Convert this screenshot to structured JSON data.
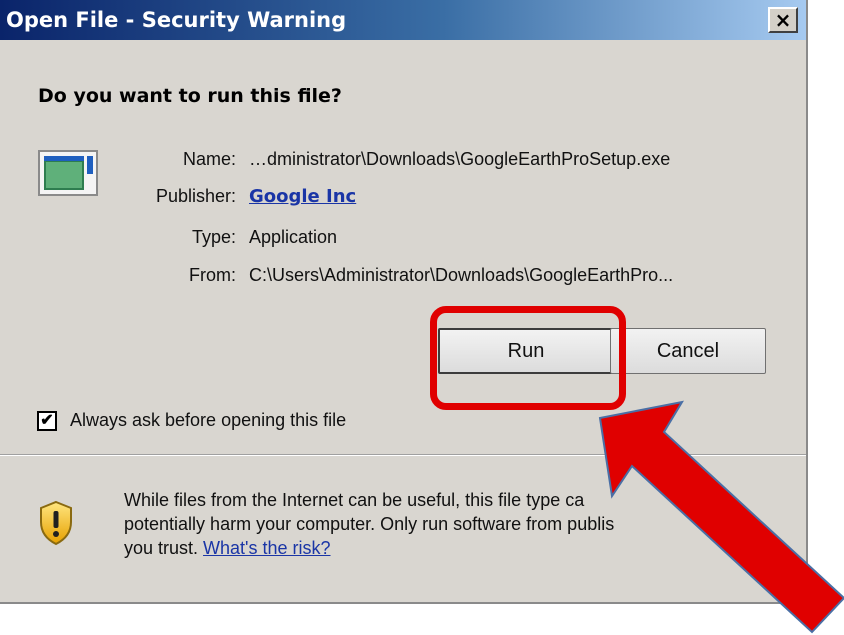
{
  "dialog": {
    "title": "Open File - Security Warning",
    "close_label": "×",
    "question": "Do you want to run this file?",
    "info": {
      "name_label": "Name:",
      "name_value": "…dministrator\\Downloads\\GoogleEarthProSetup.exe",
      "publisher_label": "Publisher:",
      "publisher_value": "Google Inc",
      "type_label": "Type:",
      "type_value": "Application",
      "from_label": "From:",
      "from_value": "C:\\Users\\Administrator\\Downloads\\GoogleEarthPro..."
    },
    "buttons": {
      "run": "Run",
      "cancel": "Cancel"
    },
    "checkbox": {
      "checked": true,
      "mark": "✔",
      "label": "Always ask before opening this file"
    },
    "warning": {
      "line1": "While files from the Internet can be useful, this file type ca",
      "line2": "potentially harm your computer. Only run software from publis",
      "line3_prefix": "you trust. ",
      "risk_link": "What's the risk?"
    }
  },
  "icons": {
    "file": "application-file-icon",
    "shield": "security-shield-icon",
    "close": "close-icon"
  },
  "annotation": {
    "highlight_color": "#e00000",
    "arrow_color": "#e00000",
    "arrow_outline": "#4a6fa5"
  }
}
